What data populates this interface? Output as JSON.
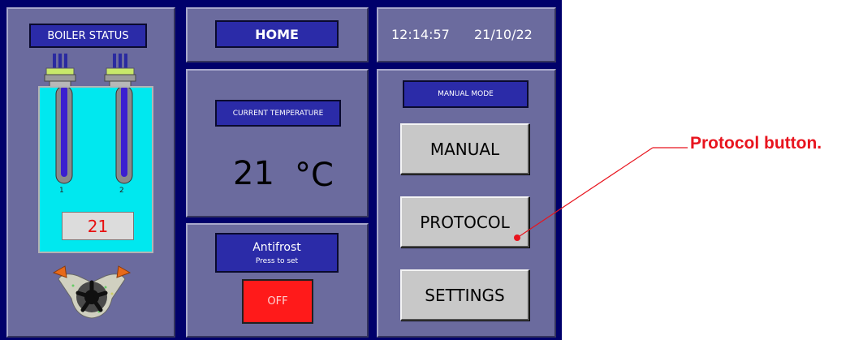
{
  "boiler": {
    "title": "BOILER STATUS",
    "heater_labels": [
      "1",
      "2"
    ],
    "temperature": "21"
  },
  "home": {
    "title": "HOME"
  },
  "clock": {
    "time": "12:14:57",
    "date": "21/10/22"
  },
  "temperature": {
    "label": "CURRENT TEMPERATURE",
    "value": "21",
    "unit": "°C"
  },
  "antifrost": {
    "title": "Antifrost",
    "hint": "Press to set",
    "state": "OFF",
    "state_color": "#ff1a1a"
  },
  "mode": {
    "label": "MANUAL MODE",
    "buttons": [
      "MANUAL",
      "PROTOCOL",
      "SETTINGS"
    ]
  },
  "annotation": {
    "text": "Protocol button.",
    "color": "#e8141e"
  },
  "icons": [
    "heater-element-icon",
    "pump-icon"
  ]
}
